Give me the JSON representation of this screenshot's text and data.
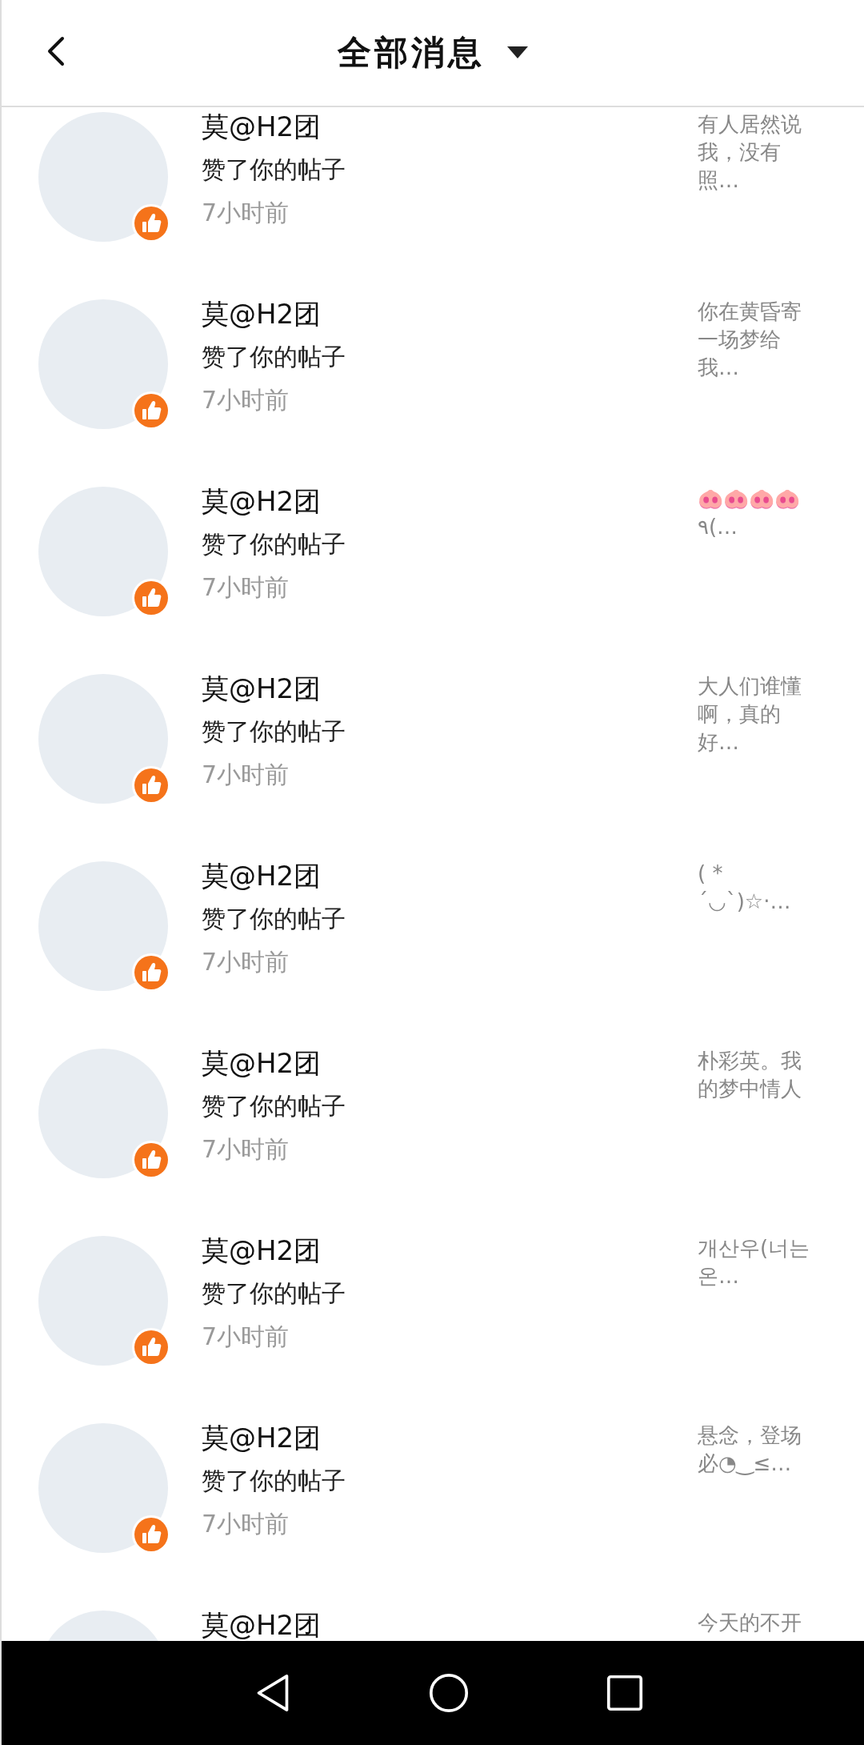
{
  "header": {
    "title": "全部消息"
  },
  "messages": [
    {
      "name": "莫@H2团",
      "action": "赞了你的帖子",
      "time": "7小时前",
      "preview": "有人居然说我，没有照…"
    },
    {
      "name": "莫@H2团",
      "action": "赞了你的帖子",
      "time": "7小时前",
      "preview": "你在黄昏寄一场梦给我…"
    },
    {
      "name": "莫@H2团",
      "action": "赞了你的帖子",
      "time": "7小时前",
      "preview": "🐽🐽🐽🐽\n٩(…"
    },
    {
      "name": "莫@H2团",
      "action": "赞了你的帖子",
      "time": "7小时前",
      "preview": "大人们谁懂啊，真的好…"
    },
    {
      "name": "莫@H2团",
      "action": "赞了你的帖子",
      "time": "7小时前",
      "preview": "( *´◡`)☆·…"
    },
    {
      "name": "莫@H2团",
      "action": "赞了你的帖子",
      "time": "7小时前",
      "preview": "朴彩英。我的梦中情人"
    },
    {
      "name": "莫@H2团",
      "action": "赞了你的帖子",
      "time": "7小时前",
      "preview": "개산우(너는 온…"
    },
    {
      "name": "莫@H2团",
      "action": "赞了你的帖子",
      "time": "7小时前",
      "preview": "悬念，登场必◔‿≤…"
    },
    {
      "name": "莫@H2团",
      "preview": "今天的不开"
    }
  ]
}
